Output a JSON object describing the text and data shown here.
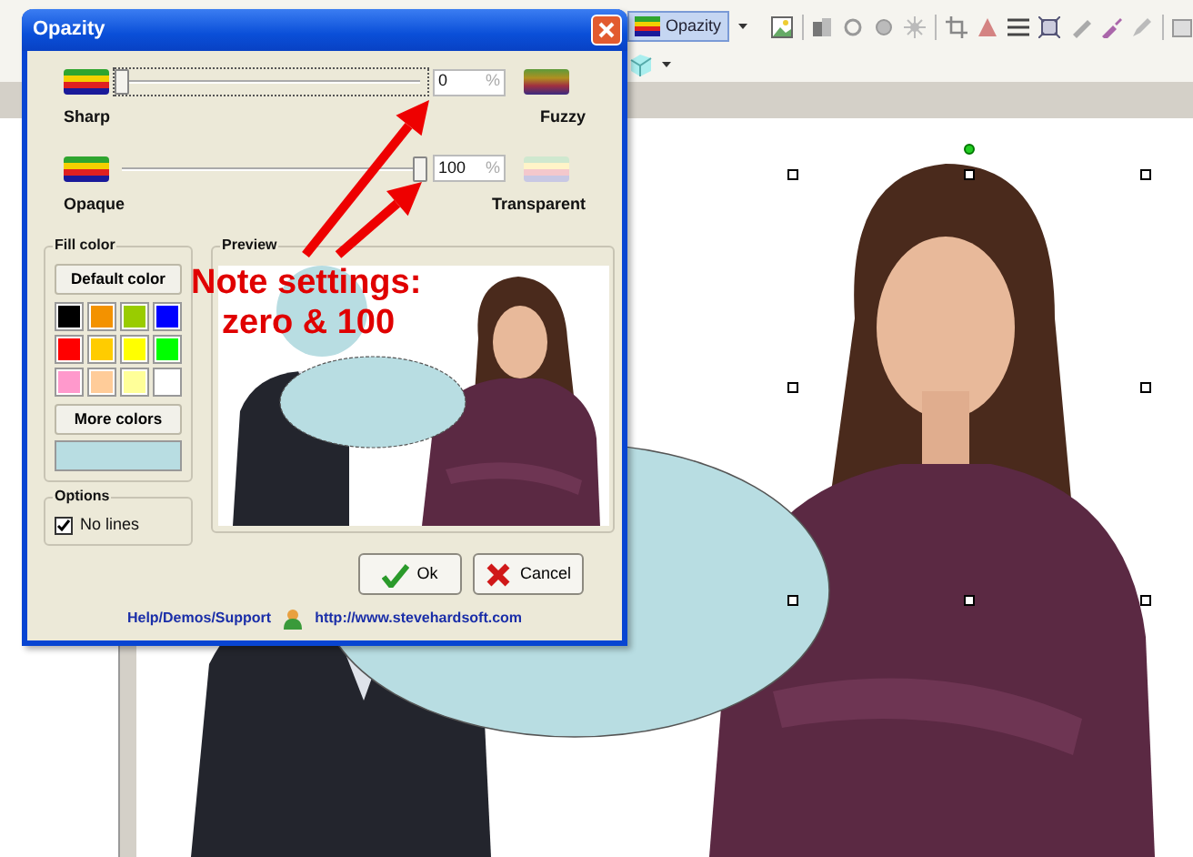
{
  "toolbar": {
    "opacity_button": "Opazity"
  },
  "dialog": {
    "title": "Opazity",
    "sliders": [
      {
        "left_label": "Sharp",
        "right_label": "Fuzzy",
        "level": 0,
        "value": "0",
        "unit": "%",
        "focused": true,
        "kind": "blur"
      },
      {
        "left_label": "Opaque",
        "right_label": "Transparent",
        "level": 1,
        "value": "100",
        "unit": "%",
        "focused": false,
        "kind": "transparency"
      }
    ],
    "fill_color": {
      "title": "Fill color",
      "default_button": "Default color",
      "swatches": [
        {
          "color": "#000000"
        },
        {
          "color": "#f39200"
        },
        {
          "color": "#99cc00"
        },
        {
          "color": "#0000ff"
        },
        {
          "color": "#ff0000"
        },
        {
          "color": "#ffcc00"
        },
        {
          "color": "#ffff00"
        },
        {
          "color": "#00ff00"
        },
        {
          "color": "#ff99cc"
        },
        {
          "color": "#ffcc99"
        },
        {
          "color": "#ffff99"
        },
        {
          "color": "#ffffff"
        }
      ],
      "more_button": "More colors"
    },
    "options": {
      "title": "Options",
      "checkboxes": [
        {
          "label": "No lines",
          "checked": true
        }
      ]
    },
    "preview": {
      "title": "Preview"
    },
    "buttons": [
      {
        "label": "Ok",
        "kind": "ok"
      },
      {
        "label": "Cancel",
        "kind": "cancel"
      }
    ],
    "footer": {
      "help_link": "Help/Demos/Support",
      "url_link": "http://www.stevehardsoft.com"
    }
  },
  "annotation": {
    "lines": [
      "Note settings:",
      "zero & 100"
    ]
  }
}
